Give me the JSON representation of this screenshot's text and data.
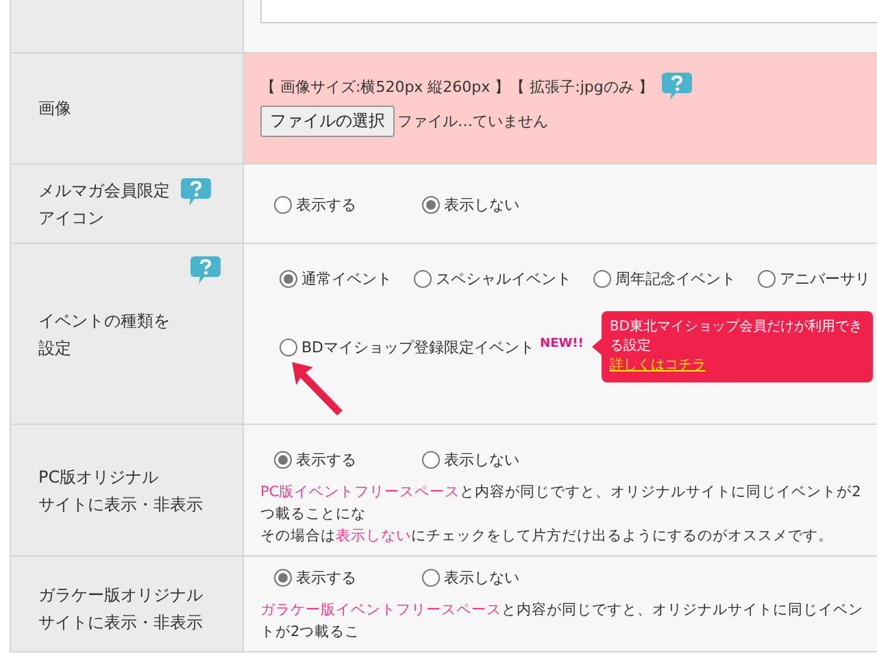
{
  "rows": [
    {
      "kind": "textarea"
    },
    {
      "kind": "file",
      "label": [
        "画像"
      ],
      "note": "【 画像サイズ:横520px 縦260px 】【 拡張子:jpgのみ 】",
      "button": "ファイルの選択",
      "file_status": "ファイル…ていません"
    },
    {
      "kind": "radio",
      "label": [
        "メルマガ会員限定",
        "アイコン"
      ],
      "options": [
        {
          "label": "表示する",
          "selected": false
        },
        {
          "label": "表示しない",
          "selected": true
        }
      ]
    },
    {
      "kind": "event",
      "label": [
        "イベントの種類を",
        "設定"
      ],
      "options": [
        {
          "label": "通常イベント",
          "selected": true
        },
        {
          "label": "スペシャルイベント",
          "selected": false
        },
        {
          "label": "周年記念イベント",
          "selected": false
        },
        {
          "label": "アニバーサリ",
          "selected": false
        }
      ],
      "special_option": {
        "label": "BDマイショップ登録限定イベント",
        "badge": "NEW!!",
        "selected": false
      },
      "tooltip": {
        "text": "BD東北マイショップ会員だけが利用できる設定",
        "link": "詳しくはコチラ"
      }
    },
    {
      "kind": "radio",
      "label": [
        "PC版オリジナル",
        "サイトに表示・非表示"
      ],
      "options": [
        {
          "label": "表示する",
          "selected": true
        },
        {
          "label": "表示しない",
          "selected": false
        }
      ],
      "note": [
        [
          {
            "text": "PC版イベントフリースペース",
            "highlight": true
          },
          {
            "text": "と内容が同じですと、オリジナルサイトに同じイベントが2つ載ることにな",
            "highlight": false
          }
        ],
        [
          {
            "text": "その場合は",
            "highlight": false
          },
          {
            "text": "表示しない",
            "highlight": true
          },
          {
            "text": "にチェックをして片方だけ出るようにするのがオススメです。",
            "highlight": false
          }
        ]
      ]
    },
    {
      "kind": "radio",
      "label": [
        "ガラケー版オリジナル",
        "サイトに表示・非表示"
      ],
      "options": [
        {
          "label": "表示する",
          "selected": true
        },
        {
          "label": "表示しない",
          "selected": false
        }
      ],
      "note": [
        [
          {
            "text": "ガラケー版イベントフリースペース",
            "highlight": true
          },
          {
            "text": "と内容が同じですと、オリジナルサイトに同じイベントが2つ載るこ",
            "highlight": false
          }
        ]
      ]
    }
  ]
}
